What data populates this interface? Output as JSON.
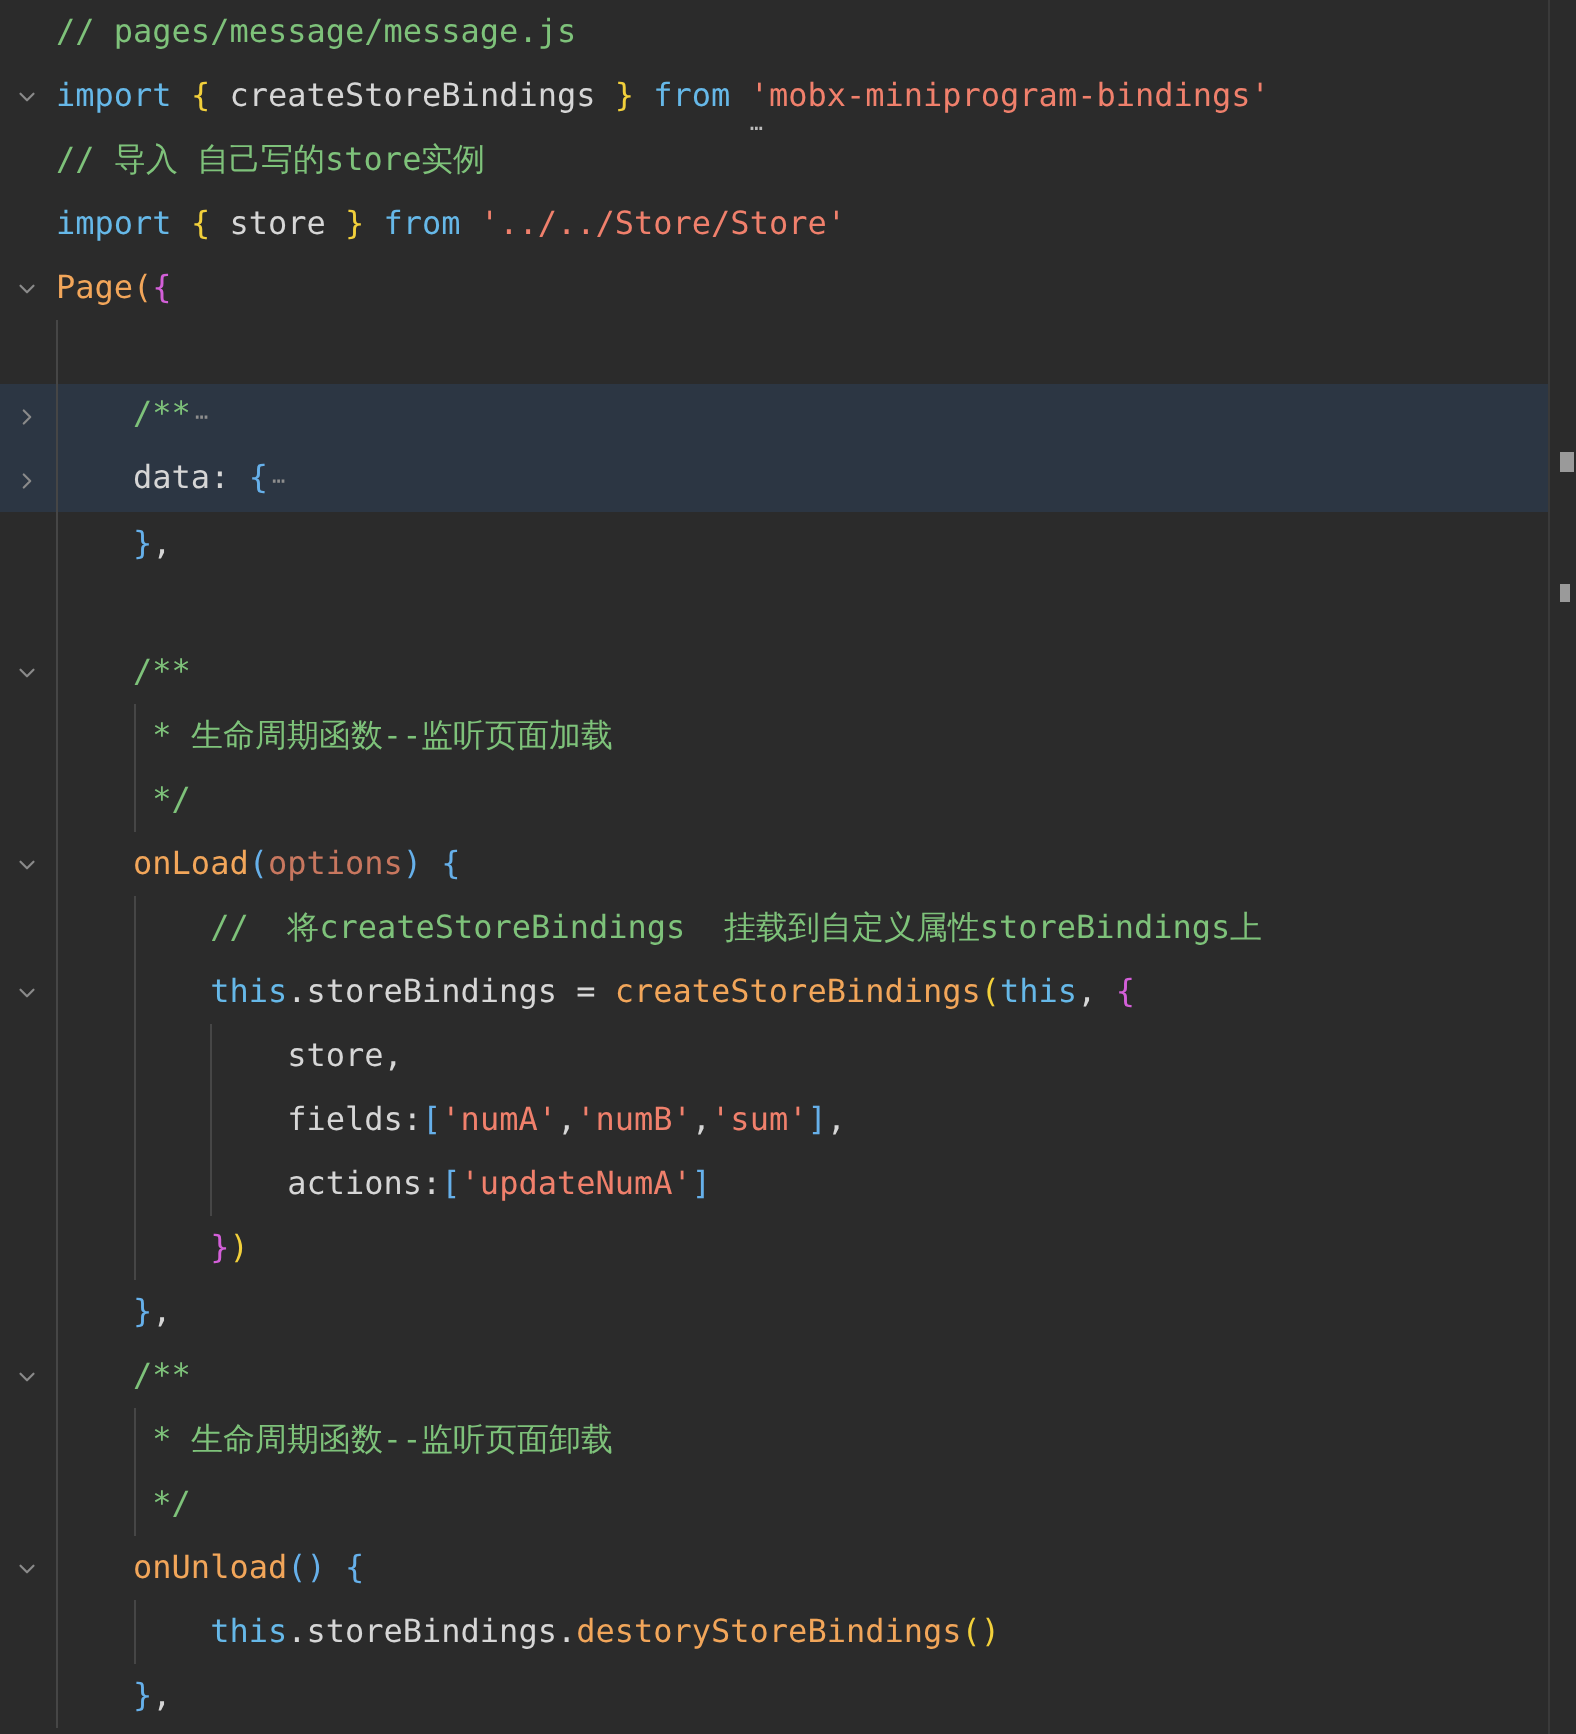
{
  "editor": {
    "lines": [
      {
        "tokens": [
          {
            "kind": "comment",
            "text": "// pages/message/message.js"
          }
        ]
      },
      {
        "expanded": true,
        "tokens": [
          {
            "kind": "keyword",
            "text": "import "
          },
          {
            "kind": "bracket",
            "text": "{"
          },
          {
            "kind": "plain",
            "text": " createStoreBindings "
          },
          {
            "kind": "bracket",
            "text": "} "
          },
          {
            "kind": "keyword",
            "text": "from "
          },
          {
            "kind": "string",
            "text": "'mobx-miniprogram-bindings'",
            "hint": "…"
          }
        ]
      },
      {
        "tokens": [
          {
            "kind": "comment",
            "text": "// 导入 自己写的store实例"
          }
        ]
      },
      {
        "tokens": [
          {
            "kind": "keyword",
            "text": "import "
          },
          {
            "kind": "bracket",
            "text": "{"
          },
          {
            "kind": "plain",
            "text": " store "
          },
          {
            "kind": "bracket",
            "text": "} "
          },
          {
            "kind": "keyword",
            "text": "from "
          },
          {
            "kind": "string",
            "text": "'../../Store/Store'"
          }
        ]
      },
      {
        "expanded": true,
        "tokens": [
          {
            "kind": "function",
            "text": "Page("
          },
          {
            "kind": "brace",
            "text": "{"
          }
        ]
      },
      {
        "kind": "blank"
      },
      {
        "expanded": false,
        "selected": true,
        "folded_marker": "⋯",
        "tokens": [
          {
            "kind": "comment",
            "text": "    /**"
          }
        ]
      },
      {
        "expanded": false,
        "selected": true,
        "folded_marker": "⋯",
        "tokens": [
          {
            "kind": "plain",
            "text": "    data: "
          },
          {
            "kind": "paren",
            "text": "{"
          }
        ]
      },
      {
        "tokens": [
          {
            "kind": "paren",
            "text": "    }"
          },
          {
            "kind": "plain",
            "text": ","
          }
        ]
      },
      {
        "kind": "blank"
      },
      {
        "expanded": true,
        "tokens": [
          {
            "kind": "comment",
            "text": "    /**"
          }
        ]
      },
      {
        "tokens": [
          {
            "kind": "comment",
            "text": "     * 生命周期函数--监听页面加载"
          }
        ]
      },
      {
        "tokens": [
          {
            "kind": "comment",
            "text": "     */"
          }
        ]
      },
      {
        "expanded": true,
        "tokens": [
          {
            "kind": "function",
            "text": "    onLoad"
          },
          {
            "kind": "paren",
            "text": "("
          },
          {
            "kind": "param",
            "text": "options"
          },
          {
            "kind": "paren",
            "text": ") {"
          }
        ]
      },
      {
        "tokens": [
          {
            "kind": "comment",
            "text": "        //  将createStoreBindings  挂载到自定义属性storeBindings上"
          }
        ]
      },
      {
        "expanded": true,
        "tokens": [
          {
            "kind": "keyword",
            "text": "        this"
          },
          {
            "kind": "plain",
            "text": ".storeBindings = "
          },
          {
            "kind": "function",
            "text": "createStoreBindings"
          },
          {
            "kind": "bracket",
            "text": "("
          },
          {
            "kind": "keyword",
            "text": "this"
          },
          {
            "kind": "plain",
            "text": ", "
          },
          {
            "kind": "brace",
            "text": "{"
          }
        ]
      },
      {
        "tokens": [
          {
            "kind": "plain",
            "text": "            store,"
          }
        ]
      },
      {
        "tokens": [
          {
            "kind": "plain",
            "text": "            fields:"
          },
          {
            "kind": "paren",
            "text": "["
          },
          {
            "kind": "string",
            "text": "'numA'"
          },
          {
            "kind": "plain",
            "text": ","
          },
          {
            "kind": "string",
            "text": "'numB'"
          },
          {
            "kind": "plain",
            "text": ","
          },
          {
            "kind": "string",
            "text": "'sum'"
          },
          {
            "kind": "paren",
            "text": "]"
          },
          {
            "kind": "plain",
            "text": ","
          }
        ]
      },
      {
        "tokens": [
          {
            "kind": "plain",
            "text": "            actions:"
          },
          {
            "kind": "paren",
            "text": "["
          },
          {
            "kind": "string",
            "text": "'updateNumA'"
          },
          {
            "kind": "paren",
            "text": "]"
          }
        ]
      },
      {
        "tokens": [
          {
            "kind": "brace",
            "text": "        }"
          },
          {
            "kind": "bracket",
            "text": ")"
          }
        ]
      },
      {
        "tokens": [
          {
            "kind": "paren",
            "text": "    }"
          },
          {
            "kind": "plain",
            "text": ","
          }
        ]
      },
      {
        "expanded": true,
        "tokens": [
          {
            "kind": "comment",
            "text": "    /**"
          }
        ]
      },
      {
        "tokens": [
          {
            "kind": "comment",
            "text": "     * 生命周期函数--监听页面卸载"
          }
        ]
      },
      {
        "tokens": [
          {
            "kind": "comment",
            "text": "     */"
          }
        ]
      },
      {
        "expanded": true,
        "tokens": [
          {
            "kind": "function",
            "text": "    onUnload"
          },
          {
            "kind": "paren",
            "text": "() {"
          }
        ]
      },
      {
        "tokens": [
          {
            "kind": "keyword",
            "text": "        this"
          },
          {
            "kind": "plain",
            "text": ".storeBindings."
          },
          {
            "kind": "function",
            "text": "destoryStoreBindings"
          },
          {
            "kind": "bracket",
            "text": "()"
          }
        ]
      },
      {
        "tokens": [
          {
            "kind": "paren",
            "text": "    }"
          },
          {
            "kind": "plain",
            "text": ","
          }
        ]
      }
    ]
  }
}
